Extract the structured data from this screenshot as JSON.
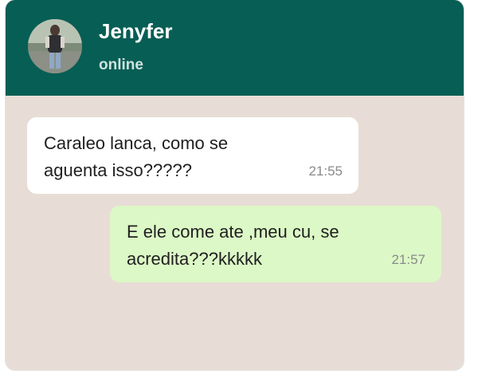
{
  "contact": {
    "name": "Jenyfer",
    "status": "online"
  },
  "messages": [
    {
      "direction": "incoming",
      "text": "Caraleo lanca, como se\naguenta isso?????",
      "time": "21:55"
    },
    {
      "direction": "outgoing",
      "text": "E ele come ate ,meu cu, se\nacredita???kkkkk",
      "time": "21:57"
    }
  ],
  "colors": {
    "header": "#075e54",
    "chat_background": "#e7ddd6",
    "incoming_bubble": "#ffffff",
    "outgoing_bubble": "#dcf8c6"
  }
}
